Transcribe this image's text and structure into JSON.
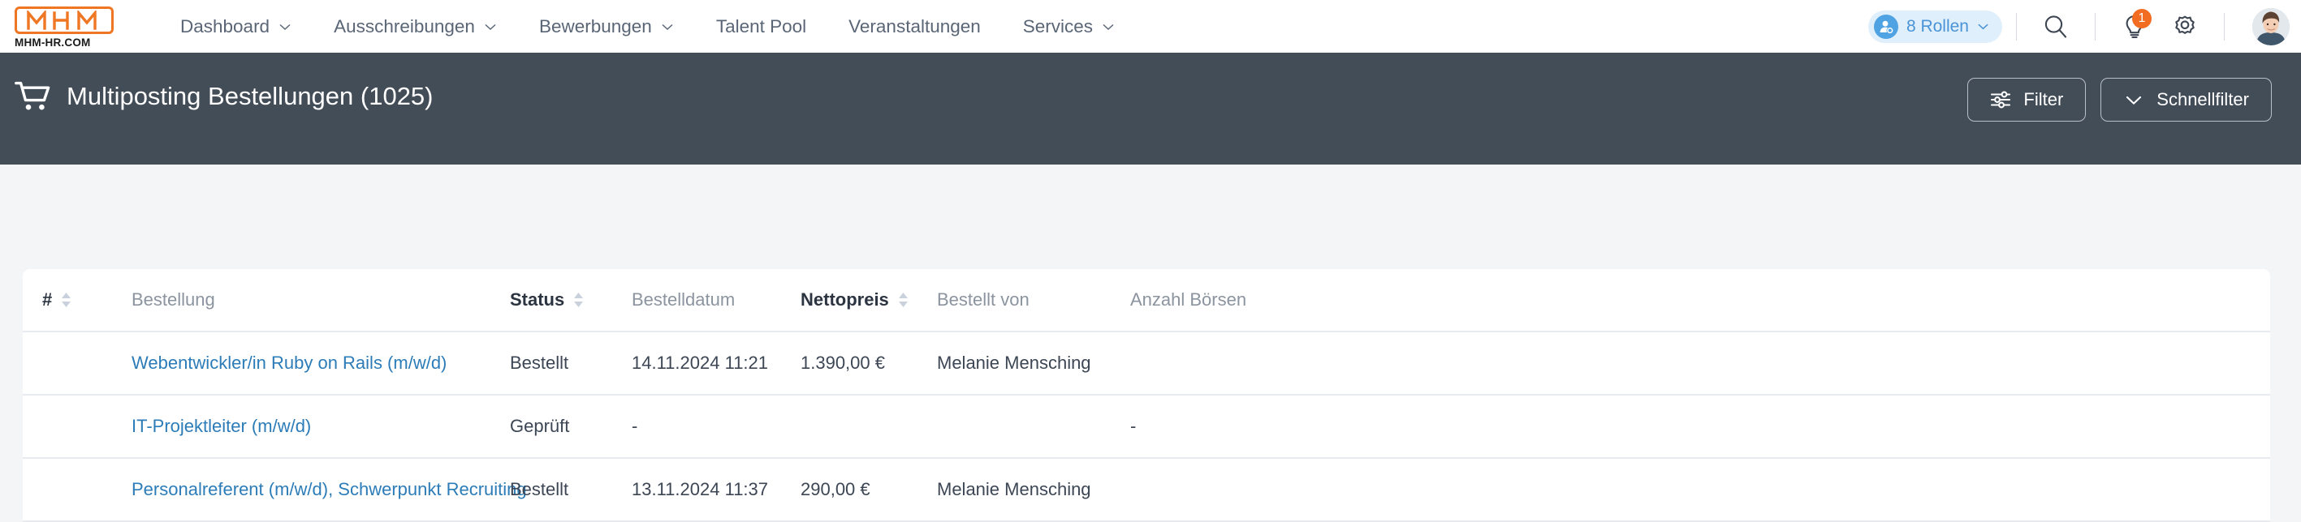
{
  "brand": {
    "logo_text": "MHM",
    "logo_subtitle": "MHM-HR.COM",
    "accent_color": "#ef7622"
  },
  "topnav": {
    "items": [
      {
        "label": "Dashboard",
        "has_caret": true
      },
      {
        "label": "Ausschreibungen",
        "has_caret": true
      },
      {
        "label": "Bewerbungen",
        "has_caret": true
      },
      {
        "label": "Talent Pool",
        "has_caret": false
      },
      {
        "label": "Veranstaltungen",
        "has_caret": false
      },
      {
        "label": "Services",
        "has_caret": true
      }
    ],
    "roles_pill": {
      "label": "8 Rollen",
      "bg_color": "#dfeffc",
      "text_color": "#4a93d6"
    },
    "icons": [
      {
        "name": "search-icon"
      },
      {
        "name": "idea-bulb-icon",
        "badge": "1"
      },
      {
        "name": "gear-icon"
      }
    ],
    "notification_badge": "1",
    "badge_color": "#f26c21"
  },
  "titlebar": {
    "icon": "shopping-cart-icon",
    "title": "Multiposting Bestellungen (1025)",
    "bg_color": "#434d58",
    "buttons": [
      {
        "label": "Filter",
        "icon": "sliders-icon",
        "icon_side": "left"
      },
      {
        "label": "Schnellfilter",
        "icon": "chevron-down-icon",
        "icon_side": "left"
      }
    ]
  },
  "table": {
    "columns": [
      {
        "key": "num",
        "label": "#",
        "sortable": true,
        "highlight": true
      },
      {
        "key": "best",
        "label": "Bestellung",
        "sortable": false,
        "highlight": false
      },
      {
        "key": "stat",
        "label": "Status",
        "sortable": true,
        "highlight": true
      },
      {
        "key": "date",
        "label": "Bestelldatum",
        "sortable": false,
        "highlight": false
      },
      {
        "key": "net",
        "label": "Nettopreis",
        "sortable": true,
        "highlight": true
      },
      {
        "key": "von",
        "label": "Bestellt von",
        "sortable": false,
        "highlight": false
      },
      {
        "key": "anz",
        "label": "Anzahl Börsen",
        "sortable": false,
        "highlight": false
      }
    ],
    "rows": [
      {
        "num": "",
        "bestellung": "Webentwickler/in Ruby on Rails (m/w/d)",
        "status": "Bestellt",
        "bestelldatum": "14.11.2024 11:21",
        "nettopreis": "1.390,00 €",
        "bestellt_von": "Melanie Mensching",
        "anzahl_boersen": ""
      },
      {
        "num": "",
        "bestellung": "IT-Projektleiter (m/w/d)",
        "status": "Geprüft",
        "bestelldatum": "-",
        "nettopreis": "",
        "bestellt_von": "",
        "anzahl_boersen": "-"
      },
      {
        "num": "",
        "bestellung": "Personalreferent (m/w/d), Schwerpunkt Recruiting",
        "status": "Bestellt",
        "bestelldatum": "13.11.2024 11:37",
        "nettopreis": "290,00 €",
        "bestellt_von": "Melanie Mensching",
        "anzahl_boersen": ""
      }
    ],
    "link_color": "#2c7cb8"
  }
}
